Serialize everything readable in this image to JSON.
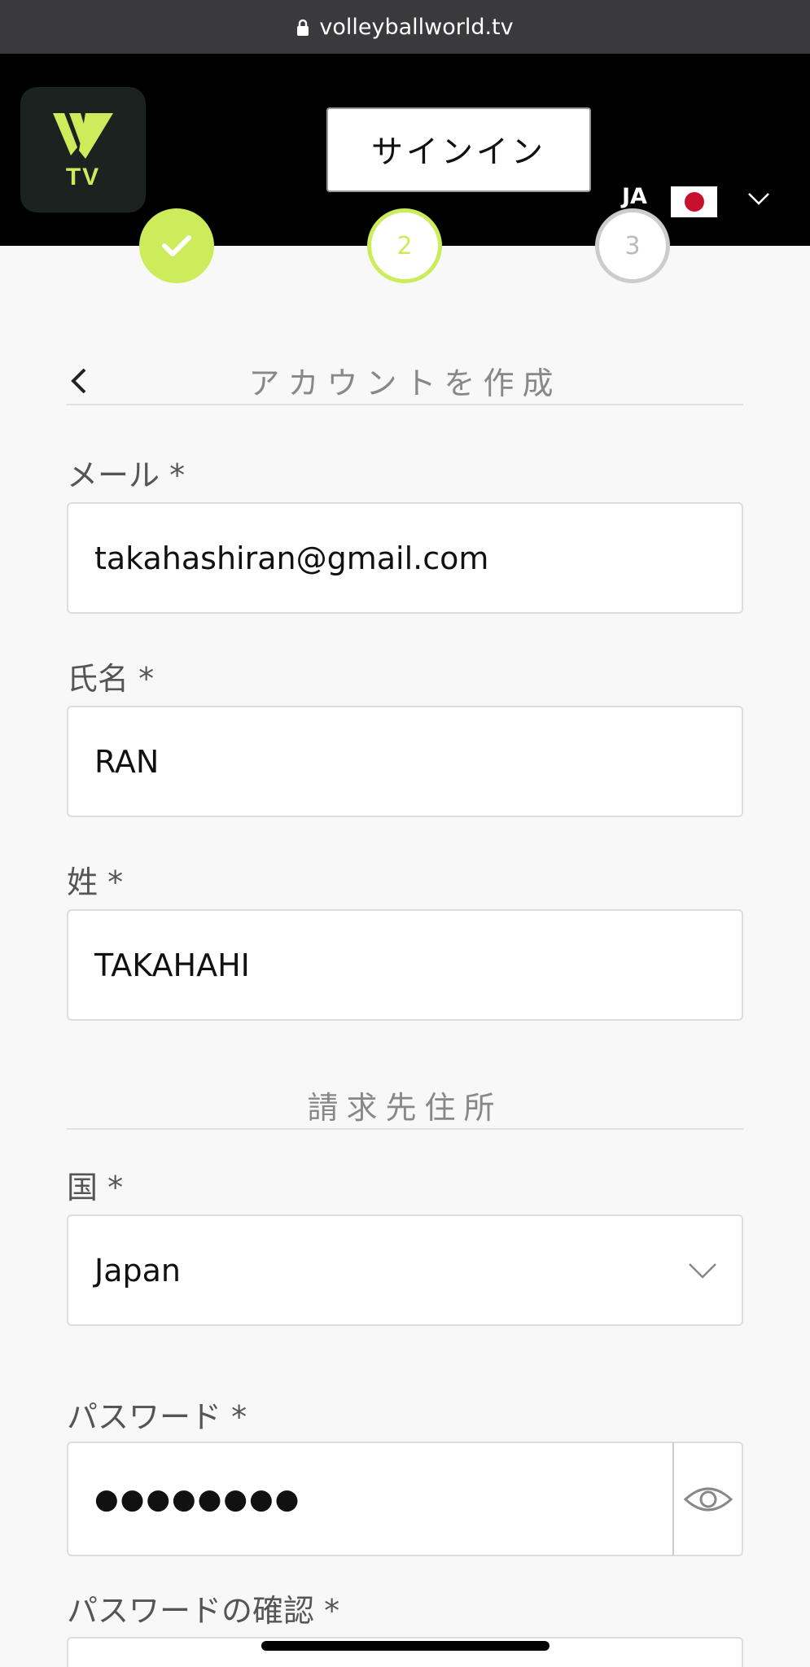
{
  "browser": {
    "url": "volleyballworld.tv"
  },
  "header": {
    "signin_label": "サインイン",
    "language_code": "JA",
    "logo_text": "TV"
  },
  "steps": [
    {
      "label": "",
      "state": "done"
    },
    {
      "label": "2",
      "state": "active"
    },
    {
      "label": "3",
      "state": "pending"
    }
  ],
  "form": {
    "title": "アカウントを作成",
    "email": {
      "label": "メール *",
      "value": "takahashiran@gmail.com"
    },
    "first_name": {
      "label": "氏名 *",
      "value": "RAN"
    },
    "last_name": {
      "label": "姓 *",
      "value": "TAKAHAHI"
    },
    "billing_title": "請求先住所",
    "country": {
      "label": "国 *",
      "value": "Japan"
    },
    "password": {
      "label": "パスワード *",
      "value": "●●●●●●●●"
    },
    "password_confirm": {
      "label": "パスワードの確認 *"
    }
  },
  "colors": {
    "accent": "#ccec5c",
    "header_bg": "#000000",
    "page_bg": "#f8f8f8"
  },
  "icons": [
    "lock-icon",
    "chevron-down-icon",
    "check-icon",
    "chevron-left-icon",
    "eye-icon"
  ]
}
